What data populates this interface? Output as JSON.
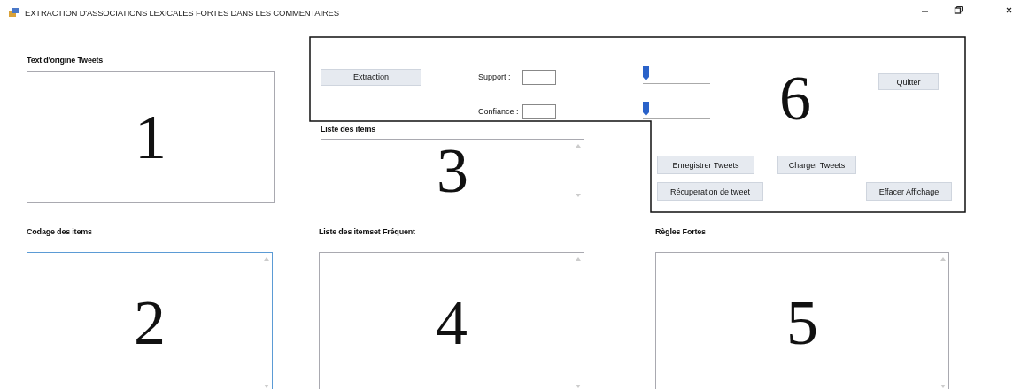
{
  "window": {
    "title": "EXTRACTION D'ASSOCIATIONS LEXICALES FORTES DANS LES COMMENTAIRES"
  },
  "panels": [
    {
      "label": "Text d'origine Tweets",
      "annotation": "1",
      "scrollbar": false,
      "focused": false
    },
    {
      "label": "Liste des items",
      "annotation": "3",
      "scrollbar": true,
      "focused": false
    },
    {
      "label": "Codage des items",
      "annotation": "2",
      "scrollbar": true,
      "focused": true
    },
    {
      "label": "Liste des itemset Fréquent",
      "annotation": "4",
      "scrollbar": true,
      "focused": false
    },
    {
      "label": "Règles Fortes",
      "annotation": "5",
      "scrollbar": true,
      "focused": false
    }
  ],
  "controls": {
    "extraction_button": "Extraction",
    "quit_button": "Quitter",
    "annotation": "6",
    "parameters": [
      {
        "label": "Support :",
        "level": 0
      },
      {
        "label": "Confiance :",
        "level": 0
      }
    ],
    "buttons": [
      "Enregistrer Tweets",
      "Charger Tweets",
      "Récuperation de tweet",
      "Effacer Affichage"
    ]
  }
}
